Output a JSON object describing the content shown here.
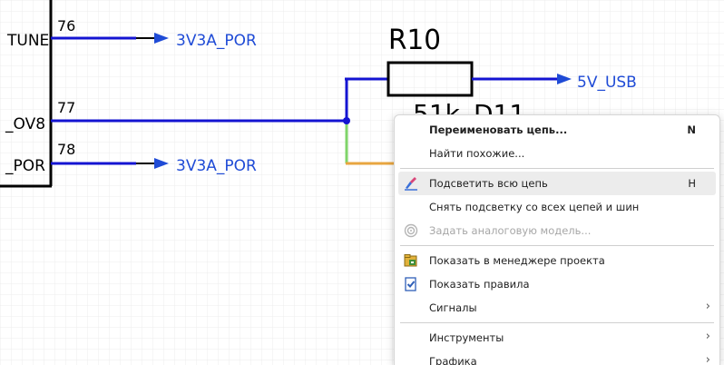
{
  "schematic": {
    "pins": [
      {
        "net": "TUNE",
        "number": "76"
      },
      {
        "net": "_OV8",
        "number": "77"
      },
      {
        "net": "_POR",
        "number": "78"
      }
    ],
    "ports": {
      "top": "3V3A_POR",
      "bottom": "3V3A_POR",
      "right": "5V_USB"
    },
    "resistor": {
      "designator": "R10",
      "value": "51k"
    },
    "diode": {
      "designator": "D11"
    }
  },
  "colors": {
    "wire": "#1414d2",
    "wire_highlight": "#7fd46a",
    "wire_orange": "#e8a640",
    "net_label": "#1f4bd6",
    "component": "#000000",
    "grid": "#ececec"
  },
  "context_menu": {
    "items": [
      {
        "label": "Переименовать цепь...",
        "shortcut": "N",
        "icon": null,
        "style": "bold"
      },
      {
        "label": "Найти похожие...",
        "icon": null
      },
      {
        "separator": true
      },
      {
        "label": "Подсветить всю цепь",
        "shortcut": "H",
        "icon": "highlight-net-icon",
        "highlighted": true
      },
      {
        "label": "Снять подсветку со всех цепей и шин",
        "icon": null
      },
      {
        "label": "Задать аналоговую модель...",
        "icon": "analog-model-icon",
        "disabled": true
      },
      {
        "separator": true
      },
      {
        "label": "Показать в менеджере проекта",
        "icon": "project-manager-icon"
      },
      {
        "label": "Показать правила",
        "icon": "rules-icon"
      },
      {
        "label": "Сигналы",
        "submenu": true
      },
      {
        "separator": true
      },
      {
        "label": "Инструменты",
        "submenu": true
      },
      {
        "label": "Графика",
        "submenu": true
      }
    ],
    "submenu_arrow": "›"
  }
}
